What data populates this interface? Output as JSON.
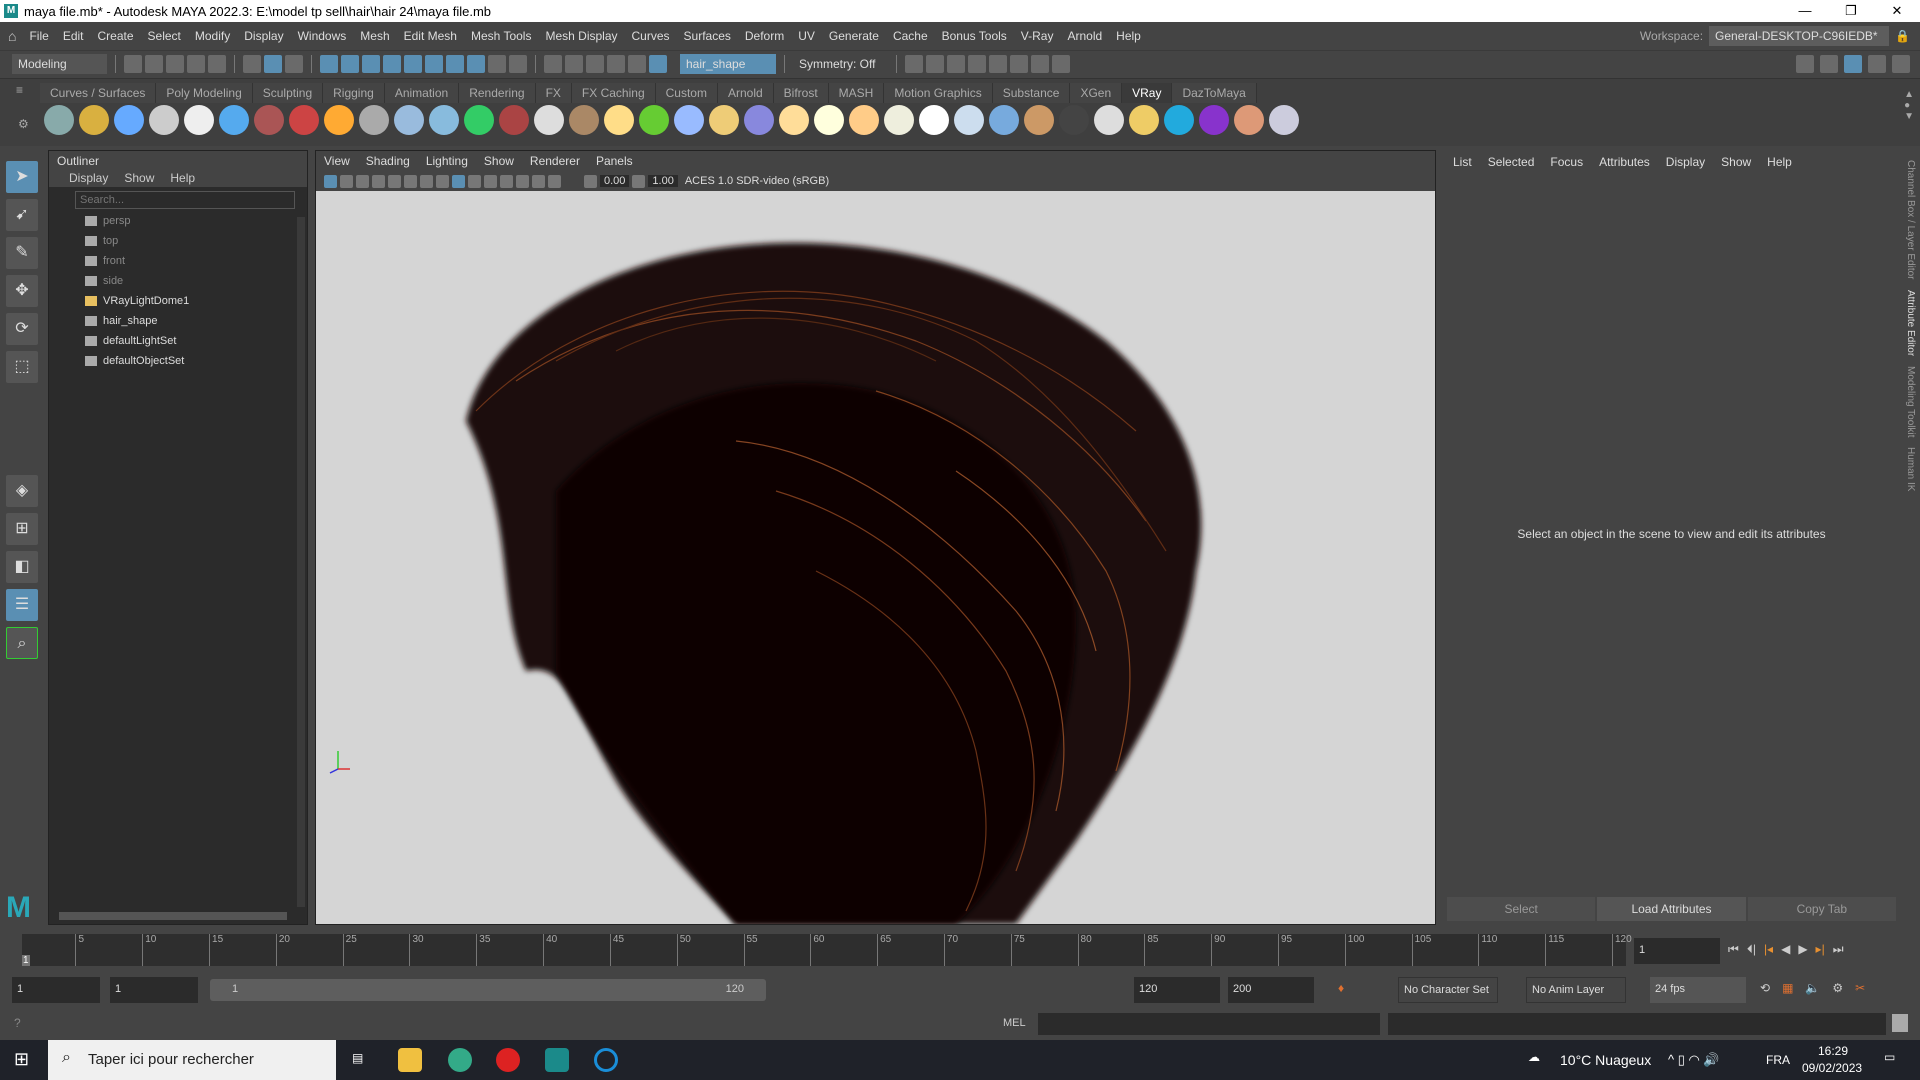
{
  "title": "maya file.mb* - Autodesk MAYA 2022.3: E:\\model tp sell\\hair\\hair 24\\maya file.mb",
  "window_controls": [
    "—",
    "❐",
    "✕"
  ],
  "menu": [
    "File",
    "Edit",
    "Create",
    "Select",
    "Modify",
    "Display",
    "Windows",
    "Mesh",
    "Edit Mesh",
    "Mesh Tools",
    "Mesh Display",
    "Curves",
    "Surfaces",
    "Deform",
    "UV",
    "Generate",
    "Cache",
    "Bonus Tools",
    "V-Ray",
    "Arnold",
    "Help"
  ],
  "workspace": {
    "label": "Workspace:",
    "value": "General-DESKTOP-C96IEDB*"
  },
  "status": {
    "mode": "Modeling",
    "selection_field": "hair_shape",
    "symmetry": "Symmetry: Off"
  },
  "shelf_tabs": [
    "Curves / Surfaces",
    "Poly Modeling",
    "Sculpting",
    "Rigging",
    "Animation",
    "Rendering",
    "FX",
    "FX Caching",
    "Custom",
    "Arnold",
    "Bifrost",
    "MASH",
    "Motion Graphics",
    "Substance",
    "XGen",
    "VRay",
    "DazToMaya"
  ],
  "shelf_active": "VRay",
  "outliner": {
    "title": "Outliner",
    "menu": [
      "Display",
      "Show",
      "Help"
    ],
    "search_placeholder": "Search...",
    "items": [
      {
        "label": "persp",
        "dim": true
      },
      {
        "label": "top",
        "dim": true
      },
      {
        "label": "front",
        "dim": true
      },
      {
        "label": "side",
        "dim": true
      },
      {
        "label": "VRayLightDome1",
        "dim": false
      },
      {
        "label": "hair_shape",
        "dim": false
      },
      {
        "label": "defaultLightSet",
        "dim": false
      },
      {
        "label": "defaultObjectSet",
        "dim": false
      }
    ]
  },
  "viewport": {
    "menu": [
      "View",
      "Shading",
      "Lighting",
      "Show",
      "Renderer",
      "Panels"
    ],
    "exposure": "0.00",
    "gamma": "1.00",
    "color_space": "ACES 1.0 SDR-video (sRGB)",
    "axis_x": "x",
    "axis_y": "y"
  },
  "attribute_editor": {
    "menu": [
      "List",
      "Selected",
      "Focus",
      "Attributes",
      "Display",
      "Show",
      "Help"
    ],
    "message": "Select an object in the scene to view and edit its attributes",
    "buttons": [
      "Select",
      "Load Attributes",
      "Copy Tab"
    ]
  },
  "side_tabs": [
    "Channel Box / Layer Editor",
    "Attribute Editor",
    "Modeling Toolkit",
    "Human IK"
  ],
  "timeline": {
    "ticks": [
      "5",
      "10",
      "15",
      "20",
      "25",
      "30",
      "35",
      "40",
      "45",
      "50",
      "55",
      "60",
      "65",
      "70",
      "75",
      "80",
      "85",
      "90",
      "95",
      "100",
      "105",
      "110",
      "115",
      "120"
    ],
    "current_frame": "1",
    "frame_field": "1"
  },
  "range": {
    "start": "1",
    "anim_start": "1",
    "slider_start": "1",
    "slider_end": "120",
    "anim_end": "120",
    "end": "200",
    "character_set": "No Character Set",
    "anim_layer": "No Anim Layer",
    "fps": "24 fps"
  },
  "command": {
    "lang": "MEL"
  },
  "taskbar": {
    "search": "Taper ici pour rechercher",
    "weather": "10°C  Nuageux",
    "lang": "FRA",
    "time": "16:29",
    "date": "09/02/2023"
  }
}
